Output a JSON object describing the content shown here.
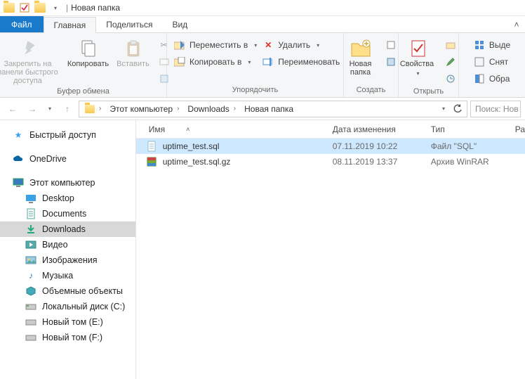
{
  "titlebar": {
    "title": "Новая папка",
    "separator": "|"
  },
  "tabs": {
    "file": "Файл",
    "home": "Главная",
    "share": "Поделиться",
    "view": "Вид"
  },
  "ribbon": {
    "clipboard": {
      "pin": "Закрепить на панели быстрого доступа",
      "copy": "Копировать",
      "paste": "Вставить",
      "group_label": "Буфер обмена"
    },
    "organize": {
      "move_to": "Переместить в",
      "copy_to": "Копировать в",
      "delete": "Удалить",
      "rename": "Переименовать",
      "group_label": "Упорядочить"
    },
    "new": {
      "new_folder": "Новая папка",
      "group_label": "Создать"
    },
    "open": {
      "properties": "Свойства",
      "group_label": "Открыть"
    },
    "select": {
      "select_all": "Выде",
      "select_none": "Снят",
      "invert": "Обра"
    }
  },
  "breadcrumb": {
    "this_pc": "Этот компьютер",
    "downloads": "Downloads",
    "folder": "Новая папка"
  },
  "search": {
    "placeholder": "Поиск: Нов"
  },
  "sidebar": {
    "quick_access": "Быстрый доступ",
    "onedrive": "OneDrive",
    "this_pc": "Этот компьютер",
    "children": [
      {
        "label": "Desktop"
      },
      {
        "label": "Documents"
      },
      {
        "label": "Downloads"
      },
      {
        "label": "Видео"
      },
      {
        "label": "Изображения"
      },
      {
        "label": "Музыка"
      },
      {
        "label": "Объемные объекты"
      },
      {
        "label": "Локальный диск (C:)"
      },
      {
        "label": "Новый том (E:)"
      },
      {
        "label": "Новый том (F:)"
      }
    ]
  },
  "columns": {
    "name": "Имя",
    "date": "Дата изменения",
    "type": "Тип",
    "size": "Ра"
  },
  "files": [
    {
      "name": "uptime_test.sql",
      "date": "07.11.2019 10:22",
      "type": "Файл \"SQL\"",
      "selected": true,
      "icon": "sql"
    },
    {
      "name": "uptime_test.sql.gz",
      "date": "08.11.2019 13:37",
      "type": "Архив WinRAR",
      "selected": false,
      "icon": "rar"
    }
  ]
}
